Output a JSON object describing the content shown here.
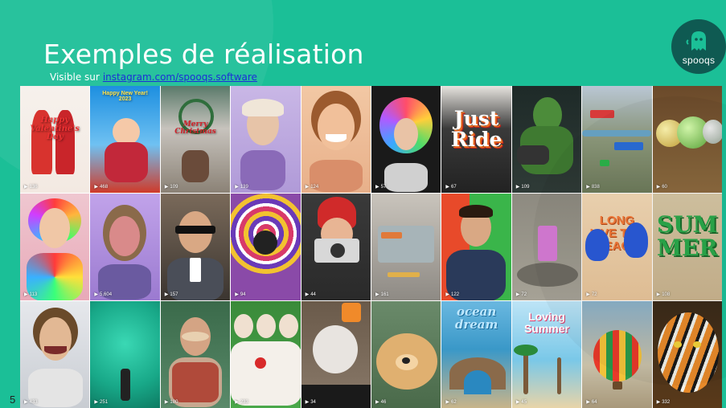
{
  "slide": {
    "title": "Exemples de réalisation",
    "subtitle_prefix": "Visible sur",
    "link_text": "instagram.com/spooqs.software",
    "page_number": "5",
    "logo_text": "spooqs"
  },
  "colors": {
    "background": "#1bbf97",
    "logo_bg": "#0f5a52",
    "link": "#1c2fd6"
  },
  "tiles": [
    {
      "views": "136",
      "scene": "red figures",
      "caption": "Happy\nValentine's\nDay"
    },
    {
      "views": "468",
      "scene": "new year kids",
      "caption": "Happy New Year!\n2023"
    },
    {
      "views": "109",
      "scene": "christmas",
      "caption": "Merry\nChristmas"
    },
    {
      "views": "139",
      "scene": "face purple"
    },
    {
      "views": "124",
      "scene": "smiling woman"
    },
    {
      "views": "57",
      "scene": "rainbow hair"
    },
    {
      "views": "67",
      "scene": "just ride",
      "caption": "Just\nRide"
    },
    {
      "views": "109",
      "scene": "green hulk"
    },
    {
      "views": "838",
      "scene": "city map"
    },
    {
      "views": "60",
      "scene": "bubbles"
    },
    {
      "views": "113",
      "scene": "woman rainbow hair"
    },
    {
      "views": "5,604",
      "scene": "face purple 2"
    },
    {
      "views": "157",
      "scene": "man sunglasses"
    },
    {
      "views": "94",
      "scene": "psychedelic rings"
    },
    {
      "views": "44",
      "scene": "camera girl"
    },
    {
      "views": "161",
      "scene": "room interior"
    },
    {
      "views": "122",
      "scene": "man green"
    },
    {
      "views": "72",
      "scene": "arc de triomphe"
    },
    {
      "views": "72",
      "scene": "long live beach",
      "caption": "LONG\nLIVE THE\nBEACH"
    },
    {
      "views": "108",
      "scene": "summer",
      "caption": "SUM\nMER"
    },
    {
      "views": "433",
      "scene": "funny face"
    },
    {
      "views": "251",
      "scene": "green floor"
    },
    {
      "views": "180",
      "scene": "woman vest"
    },
    {
      "views": "233",
      "scene": "clown dolls"
    },
    {
      "views": "34",
      "scene": "kitten"
    },
    {
      "views": "46",
      "scene": "puppy"
    },
    {
      "views": "62",
      "scene": "ocean dream",
      "caption": "ocean\ndream"
    },
    {
      "views": "45",
      "scene": "loving summer",
      "caption": "Loving\nSummer"
    },
    {
      "views": "64",
      "scene": "balloon"
    },
    {
      "views": "332",
      "scene": "tiger"
    }
  ]
}
